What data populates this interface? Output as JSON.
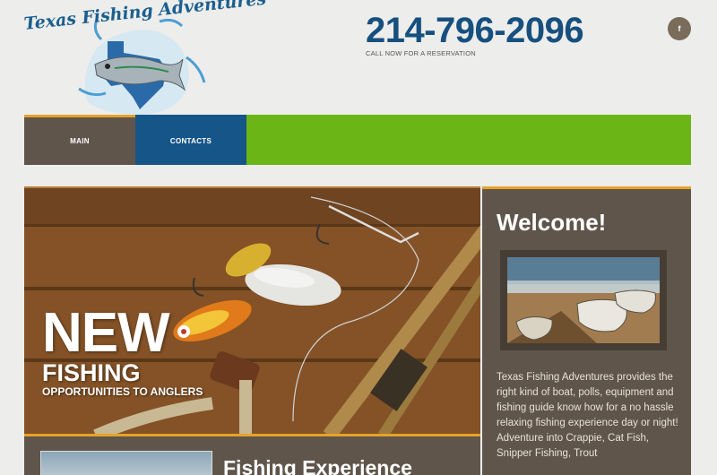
{
  "logo": {
    "text": "Texas Fishing Adventures"
  },
  "header": {
    "phone": "214-796-2096",
    "phone_sub": "CALL NOW FOR A RESERVATION",
    "facebook_label": "f"
  },
  "nav": {
    "items": [
      {
        "label": "MAIN"
      },
      {
        "label": "CONTACTS"
      }
    ]
  },
  "hero": {
    "line1": "NEW",
    "line2": "FISHING",
    "line3": "OPPORTUNITIES TO ANGLERS"
  },
  "welcome": {
    "title": "Welcome!",
    "body": "Texas Fishing Adventures provides the right kind of boat, polls, equipment and fishing guide know how for a no hassle relaxing fishing experience day or night! Adventure into Crappie, Cat Fish, Snipper Fishing, Trout"
  },
  "bottom": {
    "title": "Fishing Experience"
  },
  "colors": {
    "brand_blue": "#17507f",
    "nav_green": "#6cb516",
    "nav_brown": "#5f554b",
    "accent_orange": "#e8a228"
  }
}
